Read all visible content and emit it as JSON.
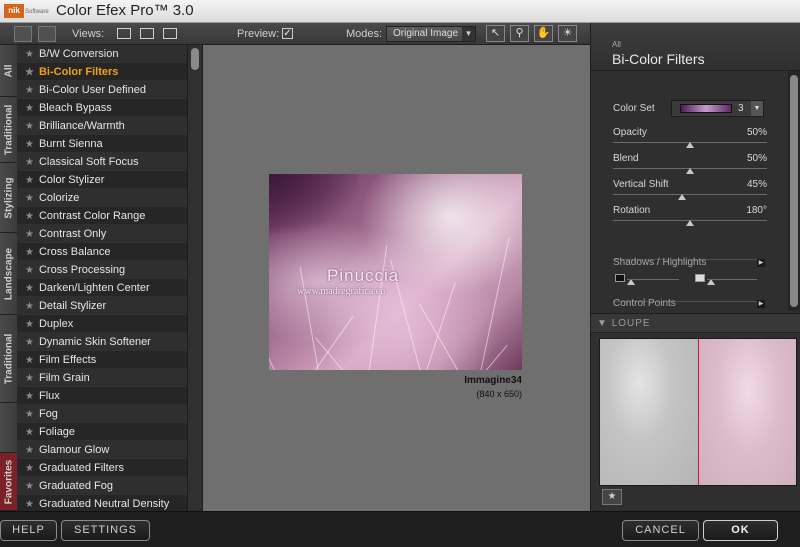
{
  "app": {
    "logo_text": "nik",
    "logo_sub": "Software",
    "title": "Color Efex Pro™ 3.0"
  },
  "toolbar": {
    "views_label": "Views:",
    "preview_label": "Preview:",
    "preview_checked": "✓",
    "modes_label": "Modes:",
    "modes_value": "Original Image",
    "tools": [
      "pointer-icon",
      "zoom-icon",
      "hand-icon",
      "light-icon"
    ]
  },
  "tabs": [
    "All",
    "Traditional",
    "Stylizing",
    "Landscape",
    "Traditional",
    "Favorites"
  ],
  "filters": [
    "B/W Conversion",
    "Bi-Color Filters",
    "Bi-Color User Defined",
    "Bleach Bypass",
    "Brilliance/Warmth",
    "Burnt Sienna",
    "Classical Soft Focus",
    "Color Stylizer",
    "Colorize",
    "Contrast Color Range",
    "Contrast Only",
    "Cross Balance",
    "Cross Processing",
    "Darken/Lighten Center",
    "Detail Stylizer",
    "Duplex",
    "Dynamic Skin Softener",
    "Film Effects",
    "Film Grain",
    "Flux",
    "Fog",
    "Foliage",
    "Glamour Glow",
    "Graduated Filters",
    "Graduated Fog",
    "Graduated Neutral Density"
  ],
  "active_filter": "Bi-Color Filters",
  "preview": {
    "watermark_name": "Pinuccia",
    "watermark_url": "www.madregrafica.eu",
    "image_name": "Immagine34",
    "image_size": "(840 x 650)"
  },
  "panel": {
    "category": "All",
    "title": "Bi-Color Filters",
    "color_set_label": "Color Set",
    "color_set_value": "3",
    "sliders": [
      {
        "label": "Opacity",
        "value": "50%",
        "level": 0.5
      },
      {
        "label": "Blend",
        "value": "50%",
        "level": 0.5
      },
      {
        "label": "Vertical Shift",
        "value": "45%",
        "level": 0.45
      },
      {
        "label": "Rotation",
        "value": "180°",
        "level": 0.5
      }
    ],
    "shadows_label": "Shadows / Highlights",
    "control_points_label": "Control Points",
    "loupe_label": "LOUPE"
  },
  "footer": {
    "help": "HELP",
    "settings": "SETTINGS",
    "cancel": "CANCEL",
    "ok": "OK"
  }
}
